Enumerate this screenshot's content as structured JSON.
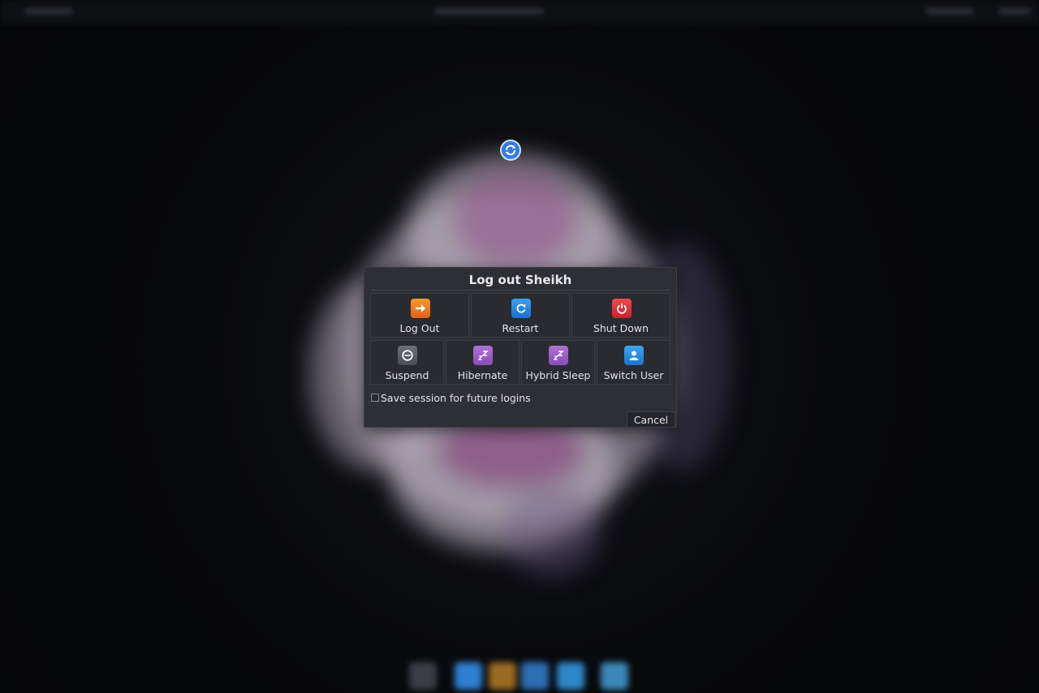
{
  "dialog": {
    "title": "Log out Sheikh",
    "actions_row1": [
      {
        "label": "Log Out",
        "icon": "log-out-arrow-icon",
        "color": "#f0821f"
      },
      {
        "label": "Restart",
        "icon": "restart-icon",
        "color": "#2a8ae8"
      },
      {
        "label": "Shut Down",
        "icon": "power-icon",
        "color": "#e03a3e"
      }
    ],
    "actions_row2": [
      {
        "label": "Suspend",
        "icon": "suspend-icon",
        "color": "#5d5f66"
      },
      {
        "label": "Hibernate",
        "icon": "hibernate-zz-icon",
        "color": "#9c5ec9"
      },
      {
        "label": "Hybrid Sleep",
        "icon": "hybrid-sleep-zz-icon",
        "color": "#9c5ec9"
      },
      {
        "label": "Switch User",
        "icon": "user-icon",
        "color": "#2a8ae8"
      }
    ],
    "save_session_label": "Save session for future logins",
    "save_session_checked": false,
    "cancel_label": "Cancel"
  },
  "background": {
    "spinner_icon": "refresh-icon",
    "wallpaper": "blurred-flower"
  }
}
